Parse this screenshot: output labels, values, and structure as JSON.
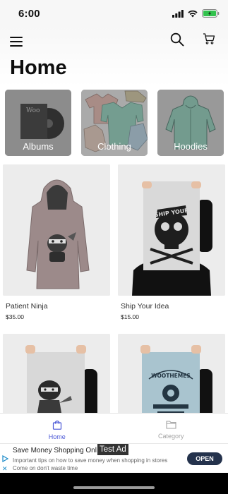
{
  "status_bar": {
    "time": "6:00"
  },
  "header": {
    "title": "Home",
    "icons": [
      "menu-icon",
      "search-icon",
      "cart-icon"
    ]
  },
  "categories": [
    {
      "label": "Albums"
    },
    {
      "label": "Clothing"
    },
    {
      "label": "Hoodies"
    }
  ],
  "products": [
    {
      "name": "Patient Ninja",
      "price": "$35.00"
    },
    {
      "name": "Ship Your Idea",
      "price": "$15.00"
    },
    {
      "name": "",
      "price": ""
    },
    {
      "name": "",
      "price": ""
    }
  ],
  "tab_bar": {
    "tabs": [
      {
        "label": "Home",
        "icon": "bag-icon",
        "active": true
      },
      {
        "label": "Category",
        "icon": "folder-icon",
        "active": false
      }
    ],
    "active_color": "#4a57d6",
    "inactive_color": "#a3a3a3"
  },
  "ad": {
    "title": "Save Money Shopping Onl",
    "tag": "Test Ad",
    "description": "Important tips on how to save money when shopping in stores Come on don't waste time",
    "button": "OPEN"
  }
}
